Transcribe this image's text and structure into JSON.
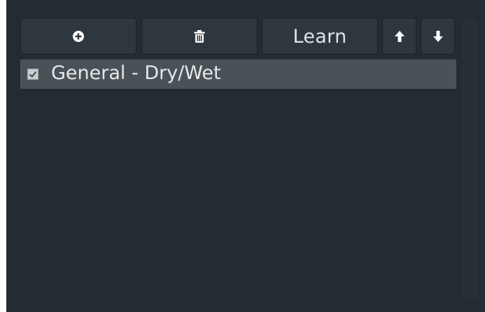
{
  "toolbar": {
    "add_icon": "plus-circle-icon",
    "delete_icon": "trash-icon",
    "learn_label": "Learn",
    "up_icon": "arrow-up-icon",
    "down_icon": "arrow-down-icon"
  },
  "list": {
    "items": [
      {
        "label": "General - Dry/Wet",
        "checked": true
      }
    ]
  },
  "colors": {
    "panel_bg": "#242c33",
    "button_bg": "#2f373e",
    "selected_row_bg": "#4b5257",
    "text": "#e4e8eb"
  }
}
